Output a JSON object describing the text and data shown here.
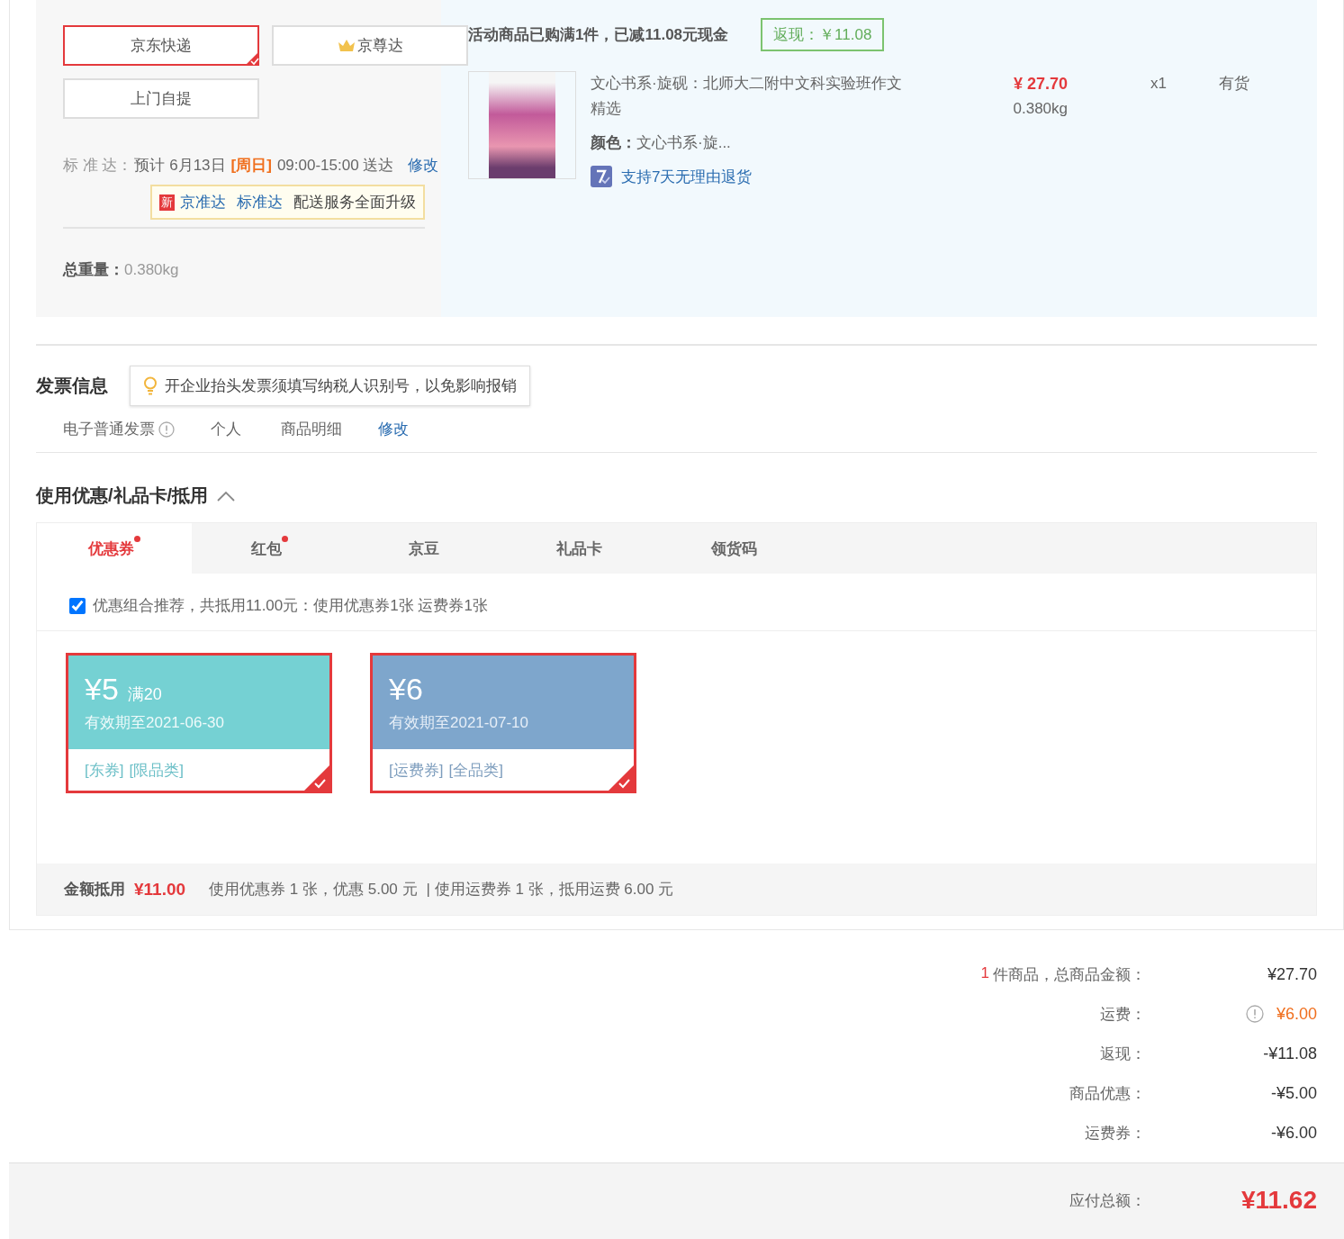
{
  "shipping": {
    "methods": [
      {
        "kind": "standard",
        "label": "京东快递",
        "selected": true
      },
      {
        "kind": "premium",
        "label": "京尊达",
        "selected": false
      },
      {
        "kind": "standard",
        "label": "上门自提",
        "selected": false
      }
    ],
    "schedule": {
      "label": "标 准 达：",
      "text": "预计 6月13日",
      "weekday": "[周日]",
      "time": "09:00-15:00 送达",
      "edit": "修改"
    },
    "promo_tip": {
      "badge": "新",
      "links": [
        "京准达",
        "标准达"
      ],
      "text": "配送服务全面升级"
    },
    "total_weight": {
      "label": "总重量：",
      "value": "0.380kg"
    }
  },
  "order": {
    "promotion": "活动商品已购满1件，已减11.08元现金",
    "cashback_tag": "返现：￥11.08",
    "item": {
      "title": "文心书系·旋砚：北师大二附中文科实验班作文精选",
      "price": "¥ 27.70",
      "weight": "0.380kg",
      "quantity": "x1",
      "stock": "有货",
      "color_label": "颜色：",
      "color_value": "文心书系·旋...",
      "return_policy": "支持7天无理由退货"
    }
  },
  "invoice": {
    "title": "发票信息",
    "tip": "开企业抬头发票须填写纳税人识别号，以免影响报销",
    "type": "电子普通发票",
    "holder": "个人",
    "content": "商品明细",
    "edit": "修改"
  },
  "discounts": {
    "title": "使用优惠/礼品卡/抵用",
    "expanded": true,
    "tabs": [
      {
        "label": "优惠券",
        "selected": true,
        "dot": true
      },
      {
        "label": "红包",
        "selected": false,
        "dot": true
      },
      {
        "label": "京豆",
        "selected": false,
        "dot": false
      },
      {
        "label": "礼品卡",
        "selected": false,
        "dot": false
      },
      {
        "label": "领货码",
        "selected": false,
        "dot": false
      }
    ],
    "recommend": {
      "checked": true,
      "text": "优惠组合推荐，共抵用11.00元：使用优惠券1张 运费券1张"
    },
    "coupons": [
      {
        "kind": "product",
        "amount": "¥5",
        "condition": "满20",
        "validity": "有效期至2021-06-30",
        "tags": [
          "[东券]",
          "[限品类]"
        ],
        "selected": true
      },
      {
        "kind": "shipping",
        "amount": "¥6",
        "validity": "有效期至2021-07-10",
        "tags": [
          "[运费券]",
          "[全品类]"
        ],
        "selected": true
      }
    ],
    "footer": {
      "label": "金额抵用",
      "amount": "¥11.00",
      "details": [
        "使用优惠券 1 张，优惠 5.00 元",
        "| 使用运费券 1 张，抵用运费 6.00 元"
      ]
    }
  },
  "summary": {
    "rows": [
      {
        "kind": "count",
        "count": "1",
        "label": "件商品，总商品金额：",
        "value": "¥27.70"
      },
      {
        "kind": "fee",
        "label": "运费：",
        "value": "¥6.00"
      },
      {
        "kind": "plain",
        "label": "返现：",
        "value": "-¥11.08"
      },
      {
        "kind": "plain",
        "label": "商品优惠：",
        "value": "-¥5.00"
      },
      {
        "kind": "plain",
        "label": "运费券：",
        "value": "-¥6.00"
      }
    ],
    "total": {
      "label": "应付总额：",
      "value": "¥11.62"
    }
  }
}
